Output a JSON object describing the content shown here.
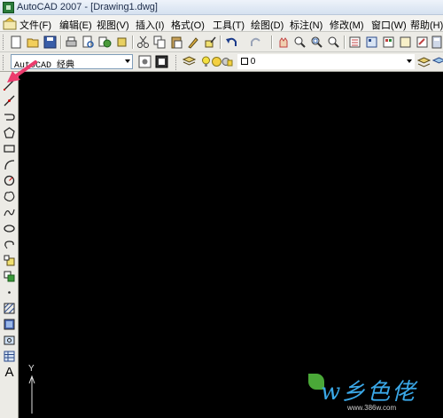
{
  "window": {
    "title": "AutoCAD 2007 - [Drawing1.dwg]"
  },
  "menu": {
    "items": [
      "文件(F)",
      "编辑(E)",
      "视图(V)",
      "插入(I)",
      "格式(O)",
      "工具(T)",
      "绘图(D)",
      "标注(N)",
      "修改(M)",
      "窗口(W)",
      "帮助(H)"
    ]
  },
  "toolbar2": {
    "workspace": "AutoCAD 经典",
    "layer": "0"
  },
  "drawing_toolbar": {
    "tools": [
      "line-icon",
      "construction-line-icon",
      "polyline-icon",
      "polygon-icon",
      "rectangle-icon",
      "arc-icon",
      "circle-icon",
      "revision-cloud-icon",
      "spline-icon",
      "ellipse-icon",
      "ellipse-arc-icon",
      "insert-block-icon",
      "make-block-icon",
      "point-icon",
      "hatch-icon",
      "gradient-icon",
      "region-icon",
      "table-icon",
      "multiline-text-icon"
    ],
    "text_tool_label": "A"
  },
  "canvas": {
    "ucs_y_label": "Y"
  },
  "watermark": {
    "brand": "w乡色佬",
    "url": "www.386w.com"
  },
  "colors": {
    "canvas_bg": "#000000",
    "accent": "#ec3b6d",
    "watermark": "#3aa8e8"
  }
}
